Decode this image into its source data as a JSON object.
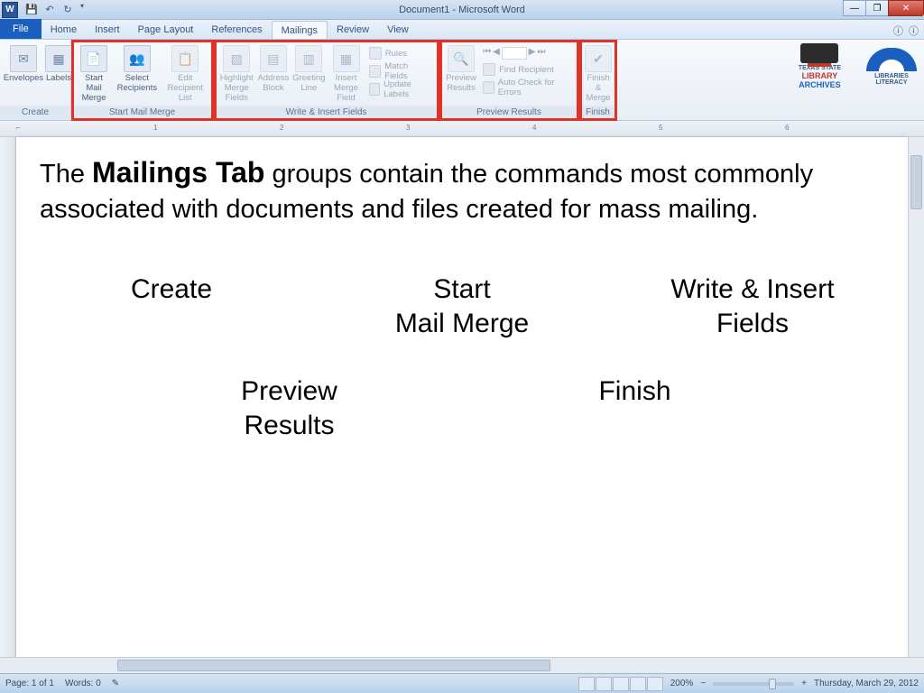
{
  "window": {
    "title": "Document1 - Microsoft Word"
  },
  "tabs": {
    "file": "File",
    "items": [
      "Home",
      "Insert",
      "Page Layout",
      "References",
      "Mailings",
      "Review",
      "View"
    ],
    "active": "Mailings"
  },
  "ribbon": {
    "groups": [
      {
        "label": "Create",
        "buttons": [
          {
            "lb": "Envelopes"
          },
          {
            "lb": "Labels"
          }
        ]
      },
      {
        "label": "Start Mail Merge",
        "buttons": [
          {
            "lb": "Start Mail\nMerge"
          },
          {
            "lb": "Select\nRecipients"
          },
          {
            "lb": "Edit\nRecipient List",
            "dis": true
          }
        ]
      },
      {
        "label": "Write & Insert Fields",
        "buttons": [
          {
            "lb": "Highlight\nMerge Fields",
            "dis": true
          },
          {
            "lb": "Address\nBlock",
            "dis": true
          },
          {
            "lb": "Greeting\nLine",
            "dis": true
          },
          {
            "lb": "Insert Merge\nField",
            "dis": true
          }
        ],
        "small": [
          "Rules",
          "Match Fields",
          "Update Labels"
        ]
      },
      {
        "label": "Preview Results",
        "buttons": [
          {
            "lb": "Preview\nResults",
            "dis": true
          }
        ],
        "small": [
          "Find Recipient",
          "Auto Check for Errors"
        ]
      },
      {
        "label": "Finish",
        "buttons": [
          {
            "lb": "Finish &\nMerge",
            "dis": true
          }
        ]
      }
    ]
  },
  "logos": {
    "l1a": "TEXAS STATE",
    "l1b": "LIBRARY",
    "l1c": "ARCHIVES",
    "l2a": "LIBRARIES",
    "l2b": "LITERACY"
  },
  "ruler": [
    "1",
    "2",
    "3",
    "4",
    "5",
    "6"
  ],
  "doc": {
    "intro_pre": "The ",
    "intro_bold": "Mailings Tab",
    "intro_post": " groups contain the commands most commonly associated with documents and files created for mass mailing.",
    "g1": "Create",
    "g2": "Start\nMail Merge",
    "g3": "Write & Insert\nFields",
    "g4": "Preview\nResults",
    "g5": "Finish"
  },
  "status": {
    "page": "Page: 1 of 1",
    "words": "Words: 0",
    "zoom": "200%",
    "date": "Thursday, March 29, 2012"
  }
}
